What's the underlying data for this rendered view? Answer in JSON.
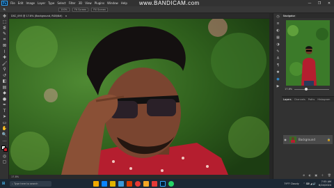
{
  "app": {
    "logo": "Ps"
  },
  "menubar": {
    "items": [
      "File",
      "Edit",
      "Image",
      "Layer",
      "Type",
      "Select",
      "Filter",
      "3D",
      "View",
      "Plugins",
      "Window",
      "Help"
    ],
    "win_controls": [
      "—",
      "❐",
      "✕"
    ]
  },
  "watermark": "www.BANDICAM.com",
  "optionsbar": {
    "boxes": [
      "100%",
      "Fit Screen",
      "Fill Screen"
    ]
  },
  "document": {
    "tab_label": "DSC_095 @ 17.8% (Background, RGB/8#)",
    "status": "17.8%"
  },
  "panels": {
    "navigator_tabs": [
      "Navigator"
    ],
    "zoom": "17.8%",
    "layers_tabs": [
      "Layers",
      "Channels",
      "Paths",
      "Histogram"
    ],
    "layer_name": "Background"
  },
  "taskbar": {
    "search_placeholder": "Type here to search",
    "weather": "79°F Cloudy",
    "time": "7:55 AM",
    "date": "6/24/2024"
  },
  "colors": {
    "accent": "#31a8ff",
    "taskbar": "#1c2733"
  }
}
